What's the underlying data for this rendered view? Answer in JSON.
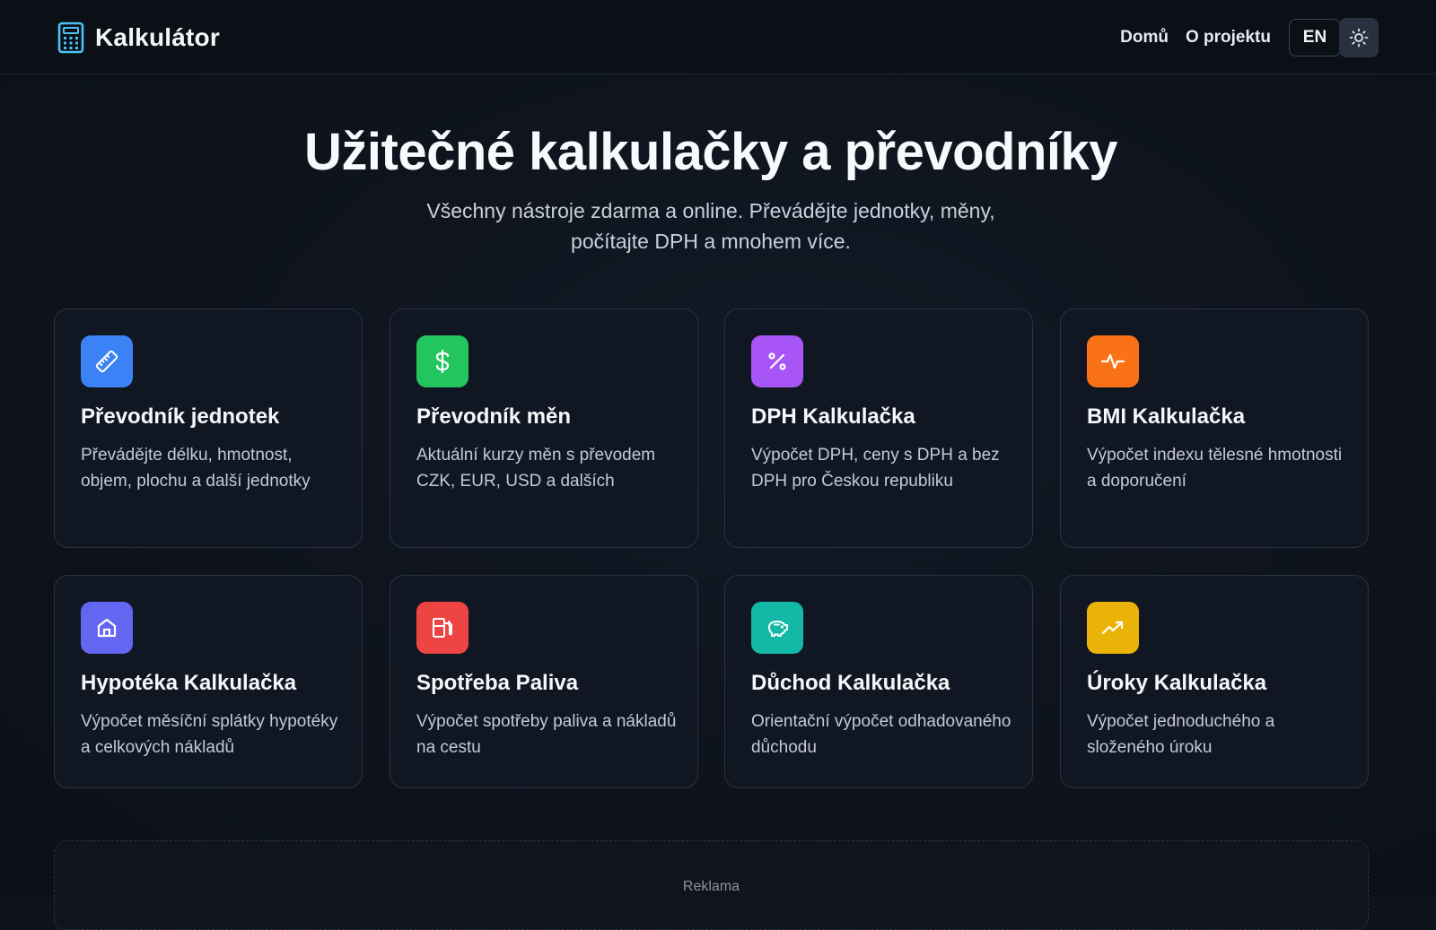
{
  "header": {
    "app_name": "Kalkulátor",
    "logo_icon": "calculator-icon",
    "nav": [
      {
        "label": "Domů"
      },
      {
        "label": "O projektu"
      }
    ],
    "language_button": "EN",
    "theme_toggle_icon": "sun-icon"
  },
  "hero": {
    "title": "Užitečné kalkulačky a převodníky",
    "subtitle_line1": "Všechny nástroje zdarma a online. Převádějte jednotky, měny,",
    "subtitle_line2": "počítajte DPH a mnohem více."
  },
  "cards": [
    {
      "title": "Převodník jednotek",
      "description": "Převádějte délku, hmotnost, objem, plochu a další jednotky",
      "icon": "ruler-icon",
      "color": "#3b82f6"
    },
    {
      "title": "Převodník měn",
      "description": "Aktuální kurzy měn s převodem CZK, EUR, USD a dalších",
      "icon": "dollar-icon",
      "color": "#22c55e"
    },
    {
      "title": "DPH Kalkulačka",
      "description": "Výpočet DPH, ceny s DPH a bez DPH pro Českou republiku",
      "icon": "percent-icon",
      "color": "#a855f7"
    },
    {
      "title": "BMI Kalkulačka",
      "description": "Výpočet indexu tělesné hmotnosti a doporučení",
      "icon": "activity-icon",
      "color": "#f97316"
    },
    {
      "title": "Hypotéka Kalkulačka",
      "description": "Výpočet měsíční splátky hypotéky a celkových nákladů",
      "icon": "home-icon",
      "color": "#6366f1"
    },
    {
      "title": "Spotřeba Paliva",
      "description": "Výpočet spotřeby paliva a nákladů na cestu",
      "icon": "fuel-icon",
      "color": "#ef4444"
    },
    {
      "title": "Důchod Kalkulačka",
      "description": "Orientační výpočet odhadovaného důchodu",
      "icon": "piggy-bank-icon",
      "color": "#14b8a6"
    },
    {
      "title": "Úroky Kalkulačka",
      "description": "Výpočet jednoduchého a složeného úroku",
      "icon": "trending-up-icon",
      "color": "#eab308"
    }
  ],
  "ad": {
    "label": "Reklama"
  }
}
